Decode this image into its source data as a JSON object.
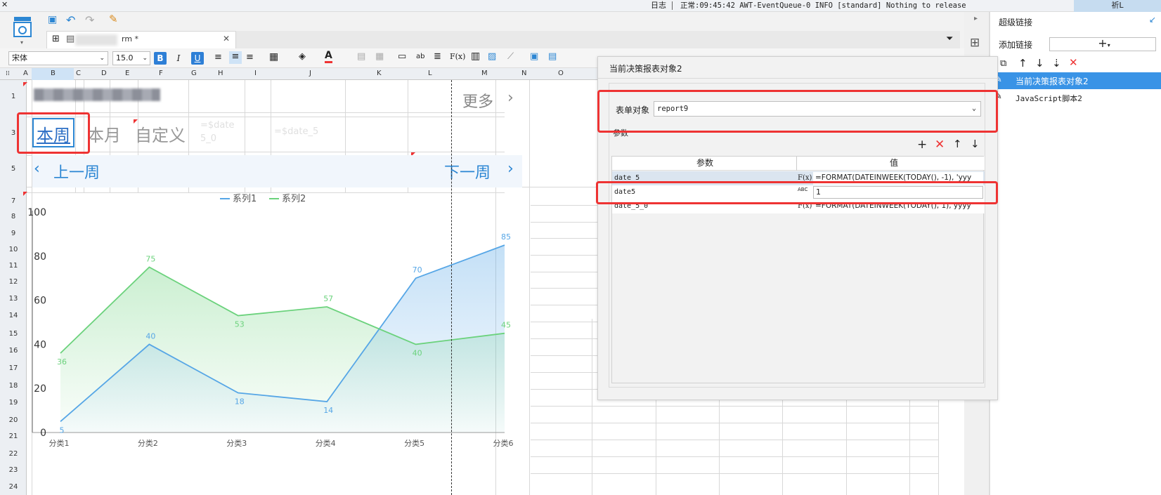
{
  "topbar": {
    "log_label": "日志",
    "status_text": "正常:09:45:42 AWT-EventQueue-0 INFO [standard] Nothing to release",
    "user_label": "祈L"
  },
  "tab": {
    "title": "rm *"
  },
  "format": {
    "font_name": "宋体",
    "font_size": "15.0",
    "bold": "B",
    "italic": "I",
    "underline": "U"
  },
  "columns": [
    "A",
    "B",
    "C",
    "D",
    "E",
    "F",
    "G",
    "H",
    "I",
    "J",
    "K",
    "L",
    "M",
    "N",
    "O"
  ],
  "rows": [
    "1",
    "3",
    "5",
    "7",
    "8",
    "9",
    "10",
    "11",
    "12",
    "13",
    "14",
    "15",
    "16",
    "17",
    "18",
    "19",
    "20",
    "21",
    "22",
    "23",
    "24"
  ],
  "report": {
    "more_label": "更多",
    "tabs": [
      "本周",
      "本月",
      "自定义"
    ],
    "formula_a": "=$date",
    "formula_a2": "5_0",
    "formula_b": "=$date_5",
    "prev_week": "上一周",
    "next_week": "下一周"
  },
  "chart_data": {
    "type": "area",
    "categories": [
      "分类1",
      "分类2",
      "分类3",
      "分类4",
      "分类5",
      "分类6"
    ],
    "series": [
      {
        "name": "系列1",
        "values": [
          5,
          40,
          18,
          14,
          70,
          85
        ],
        "color": "#56a6e6"
      },
      {
        "name": "系列2",
        "values": [
          36,
          75,
          53,
          57,
          40,
          45
        ],
        "color": "#6bd27c"
      }
    ],
    "ylim": [
      0,
      100
    ],
    "yticks": [
      "0",
      "20",
      "40",
      "60",
      "80",
      "100"
    ],
    "legend": "top-center",
    "grid": false
  },
  "dialog": {
    "title": "当前决策报表对象2",
    "form_object_label": "表单对象",
    "form_object_value": "report9",
    "params_label": "参数",
    "col_param": "参数",
    "col_value": "值",
    "params": [
      {
        "name": "date_5",
        "type": "F(x)",
        "value": "=FORMAT(DATEINWEEK(TODAY(), -1), 'yyy"
      },
      {
        "name": "date5",
        "type": "ABC",
        "value": "1"
      },
      {
        "name": "date_5_0",
        "type": "F(x)",
        "value": "=FORMAT(DATEINWEEK(TODAY(), 1), yyyy"
      }
    ]
  },
  "rightpanel": {
    "title": "超级链接",
    "add_link_label": "添加链接",
    "add_symbol": "+",
    "items": [
      "当前决策报表对象2",
      "JavaScript脚本2"
    ]
  }
}
